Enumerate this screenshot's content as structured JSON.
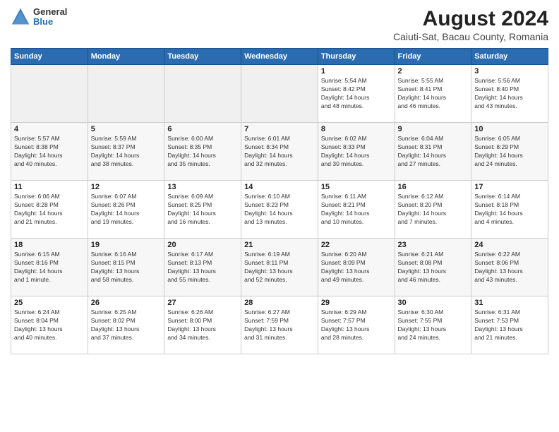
{
  "logo": {
    "general": "General",
    "blue": "Blue"
  },
  "title": "August 2024",
  "subtitle": "Caiuti-Sat, Bacau County, Romania",
  "header_days": [
    "Sunday",
    "Monday",
    "Tuesday",
    "Wednesday",
    "Thursday",
    "Friday",
    "Saturday"
  ],
  "weeks": [
    [
      {
        "day": "",
        "info": ""
      },
      {
        "day": "",
        "info": ""
      },
      {
        "day": "",
        "info": ""
      },
      {
        "day": "",
        "info": ""
      },
      {
        "day": "1",
        "info": "Sunrise: 5:54 AM\nSunset: 8:42 PM\nDaylight: 14 hours\nand 48 minutes."
      },
      {
        "day": "2",
        "info": "Sunrise: 5:55 AM\nSunset: 8:41 PM\nDaylight: 14 hours\nand 46 minutes."
      },
      {
        "day": "3",
        "info": "Sunrise: 5:56 AM\nSunset: 8:40 PM\nDaylight: 14 hours\nand 43 minutes."
      }
    ],
    [
      {
        "day": "4",
        "info": "Sunrise: 5:57 AM\nSunset: 8:38 PM\nDaylight: 14 hours\nand 40 minutes."
      },
      {
        "day": "5",
        "info": "Sunrise: 5:59 AM\nSunset: 8:37 PM\nDaylight: 14 hours\nand 38 minutes."
      },
      {
        "day": "6",
        "info": "Sunrise: 6:00 AM\nSunset: 8:35 PM\nDaylight: 14 hours\nand 35 minutes."
      },
      {
        "day": "7",
        "info": "Sunrise: 6:01 AM\nSunset: 8:34 PM\nDaylight: 14 hours\nand 32 minutes."
      },
      {
        "day": "8",
        "info": "Sunrise: 6:02 AM\nSunset: 8:33 PM\nDaylight: 14 hours\nand 30 minutes."
      },
      {
        "day": "9",
        "info": "Sunrise: 6:04 AM\nSunset: 8:31 PM\nDaylight: 14 hours\nand 27 minutes."
      },
      {
        "day": "10",
        "info": "Sunrise: 6:05 AM\nSunset: 8:29 PM\nDaylight: 14 hours\nand 24 minutes."
      }
    ],
    [
      {
        "day": "11",
        "info": "Sunrise: 6:06 AM\nSunset: 8:28 PM\nDaylight: 14 hours\nand 21 minutes."
      },
      {
        "day": "12",
        "info": "Sunrise: 6:07 AM\nSunset: 8:26 PM\nDaylight: 14 hours\nand 19 minutes."
      },
      {
        "day": "13",
        "info": "Sunrise: 6:09 AM\nSunset: 8:25 PM\nDaylight: 14 hours\nand 16 minutes."
      },
      {
        "day": "14",
        "info": "Sunrise: 6:10 AM\nSunset: 8:23 PM\nDaylight: 14 hours\nand 13 minutes."
      },
      {
        "day": "15",
        "info": "Sunrise: 6:11 AM\nSunset: 8:21 PM\nDaylight: 14 hours\nand 10 minutes."
      },
      {
        "day": "16",
        "info": "Sunrise: 6:12 AM\nSunset: 8:20 PM\nDaylight: 14 hours\nand 7 minutes."
      },
      {
        "day": "17",
        "info": "Sunrise: 6:14 AM\nSunset: 8:18 PM\nDaylight: 14 hours\nand 4 minutes."
      }
    ],
    [
      {
        "day": "18",
        "info": "Sunrise: 6:15 AM\nSunset: 8:16 PM\nDaylight: 14 hours\nand 1 minute."
      },
      {
        "day": "19",
        "info": "Sunrise: 6:16 AM\nSunset: 8:15 PM\nDaylight: 13 hours\nand 58 minutes."
      },
      {
        "day": "20",
        "info": "Sunrise: 6:17 AM\nSunset: 8:13 PM\nDaylight: 13 hours\nand 55 minutes."
      },
      {
        "day": "21",
        "info": "Sunrise: 6:19 AM\nSunset: 8:11 PM\nDaylight: 13 hours\nand 52 minutes."
      },
      {
        "day": "22",
        "info": "Sunrise: 6:20 AM\nSunset: 8:09 PM\nDaylight: 13 hours\nand 49 minutes."
      },
      {
        "day": "23",
        "info": "Sunrise: 6:21 AM\nSunset: 8:08 PM\nDaylight: 13 hours\nand 46 minutes."
      },
      {
        "day": "24",
        "info": "Sunrise: 6:22 AM\nSunset: 8:06 PM\nDaylight: 13 hours\nand 43 minutes."
      }
    ],
    [
      {
        "day": "25",
        "info": "Sunrise: 6:24 AM\nSunset: 8:04 PM\nDaylight: 13 hours\nand 40 minutes."
      },
      {
        "day": "26",
        "info": "Sunrise: 6:25 AM\nSunset: 8:02 PM\nDaylight: 13 hours\nand 37 minutes."
      },
      {
        "day": "27",
        "info": "Sunrise: 6:26 AM\nSunset: 8:00 PM\nDaylight: 13 hours\nand 34 minutes."
      },
      {
        "day": "28",
        "info": "Sunrise: 6:27 AM\nSunset: 7:59 PM\nDaylight: 13 hours\nand 31 minutes."
      },
      {
        "day": "29",
        "info": "Sunrise: 6:29 AM\nSunset: 7:57 PM\nDaylight: 13 hours\nand 28 minutes."
      },
      {
        "day": "30",
        "info": "Sunrise: 6:30 AM\nSunset: 7:55 PM\nDaylight: 13 hours\nand 24 minutes."
      },
      {
        "day": "31",
        "info": "Sunrise: 6:31 AM\nSunset: 7:53 PM\nDaylight: 13 hours\nand 21 minutes."
      }
    ]
  ]
}
